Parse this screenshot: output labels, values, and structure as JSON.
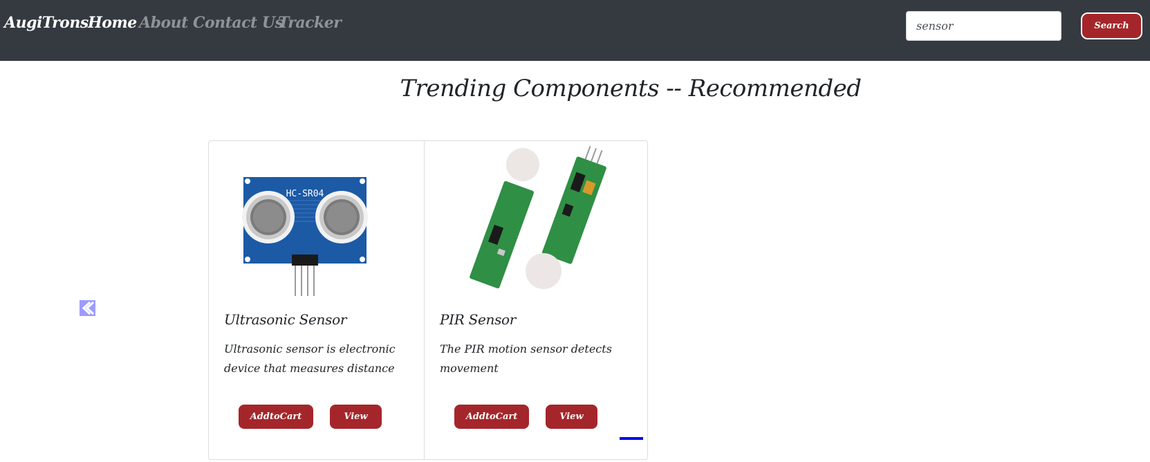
{
  "navbar": {
    "brand": "AugiTrons",
    "links": [
      {
        "label": "Home",
        "active": true
      },
      {
        "label": "About",
        "active": false
      },
      {
        "label": "Contact Us",
        "active": false
      },
      {
        "label": "Tracker",
        "active": false
      }
    ],
    "search": {
      "value": "sensor",
      "button_label": "Search"
    }
  },
  "main": {
    "title": "Trending Components -- Recommended",
    "carousel": {
      "prev_icon": "chevron-left-icon",
      "cards": [
        {
          "title": "Ultrasonic Sensor",
          "description": "Ultrasonic sensor is electronic device that measures distance",
          "image_label": "HC-SR04",
          "add_label": "AddtoCart",
          "view_label": "View"
        },
        {
          "title": "PIR Sensor",
          "description": "The PIR motion sensor detects movement",
          "add_label": "AddtoCart",
          "view_label": "View"
        }
      ]
    }
  },
  "colors": {
    "navbar": "#343a40",
    "accent": "#a4262a",
    "prev_button": "#9d9cff",
    "indicator": "#0000ee"
  }
}
